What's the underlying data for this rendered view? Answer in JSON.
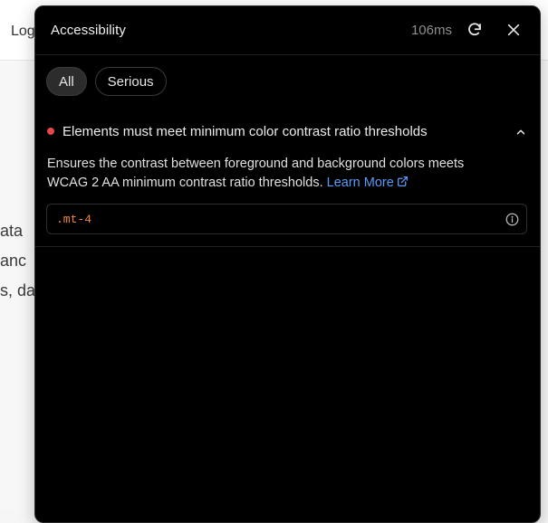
{
  "background": {
    "nav_text": "Log",
    "text_fragments": [
      "ata",
      "anc",
      "s, da"
    ]
  },
  "panel": {
    "title": "Accessibility",
    "timing": "106ms",
    "refresh_icon": "refresh-icon",
    "close_icon": "close-icon"
  },
  "filters": [
    {
      "label": "All",
      "active": true
    },
    {
      "label": "Serious",
      "active": false
    }
  ],
  "issue": {
    "severity_color": "#e5484d",
    "title": "Elements must meet minimum color contrast ratio thresholds",
    "description": "Ensures the contrast between foreground and background colors meets WCAG 2 AA minimum contrast ratio thresholds.",
    "learn_more_label": "Learn More",
    "expanded": true,
    "selector": ".mt-4",
    "selector_color": "#f0883e",
    "link_color": "#5b9bf8"
  }
}
